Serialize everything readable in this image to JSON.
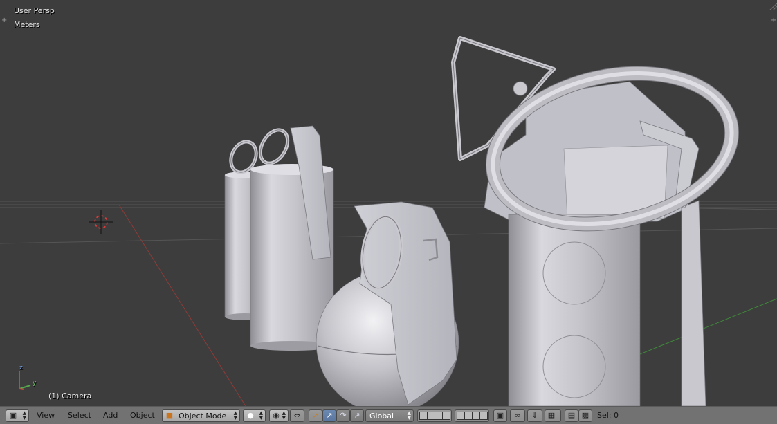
{
  "viewport": {
    "view_name": "User Persp",
    "units": "Meters",
    "active_object": "(1) Camera",
    "axes": {
      "z": "z",
      "y": "y"
    }
  },
  "header": {
    "editor_type_icon": "cube-editor-icon",
    "menus": [
      "View",
      "Select",
      "Add",
      "Object"
    ],
    "mode": {
      "label": "Object Mode",
      "icon": "object-mode-cube-icon"
    },
    "shading_icon": "solid-shading-sphere-icon",
    "pivot_icon": "pivot-point-icon",
    "manipulator_icons": [
      "manipulator-axes-icon",
      "translate-icon",
      "rotate-icon",
      "scale-icon"
    ],
    "orientation": "Global",
    "layer_blocks": 2,
    "lock_icon": "lock-camera-icon",
    "snap_icons": [
      "proportional-edit-icon",
      "snap-magnet-icon",
      "snap-target-icon"
    ],
    "render_icons": [
      "render-image-icon",
      "render-animation-icon"
    ],
    "status": "Sel: 0"
  },
  "colors": {
    "viewport_bg": "#3d3d3d",
    "header_bg": "#727272",
    "model": "#c6c6cc",
    "x_axis": "#a0403d",
    "y_axis": "#3f8a3a",
    "selected_button": "#5a76a0"
  }
}
